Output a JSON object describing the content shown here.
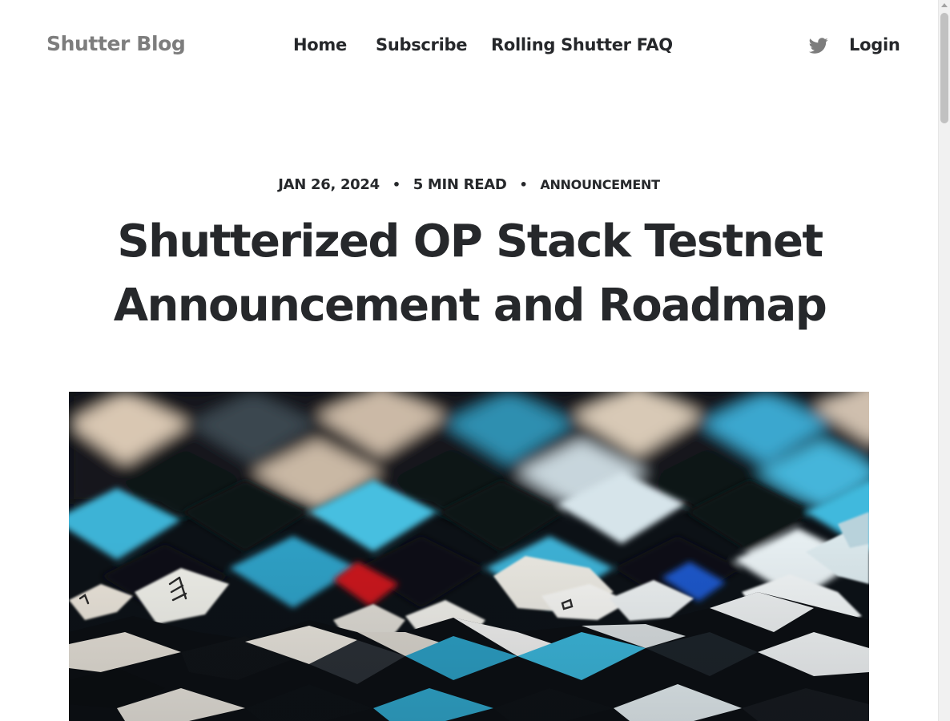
{
  "site": {
    "brand": "Shutter Blog",
    "nav": [
      "Home",
      "Subscribe",
      "Rolling Shutter FAQ"
    ],
    "twitter_icon": "twitter-icon",
    "login_label": "Login"
  },
  "post": {
    "date": "JAN 26, 2024",
    "reading_time": "5 MIN READ",
    "tag": "ANNOUNCEMENT",
    "separator": "•",
    "title_line1": "Shutterized OP Stack Testnet",
    "title_line2": "Announcement and Roadmap",
    "feature_image": "abstract-blurred-keyboard-lattice-image"
  },
  "colors": {
    "text": "#26282b",
    "brand": "#7d7d7d",
    "accent_cyan": "#3fb8d8"
  }
}
